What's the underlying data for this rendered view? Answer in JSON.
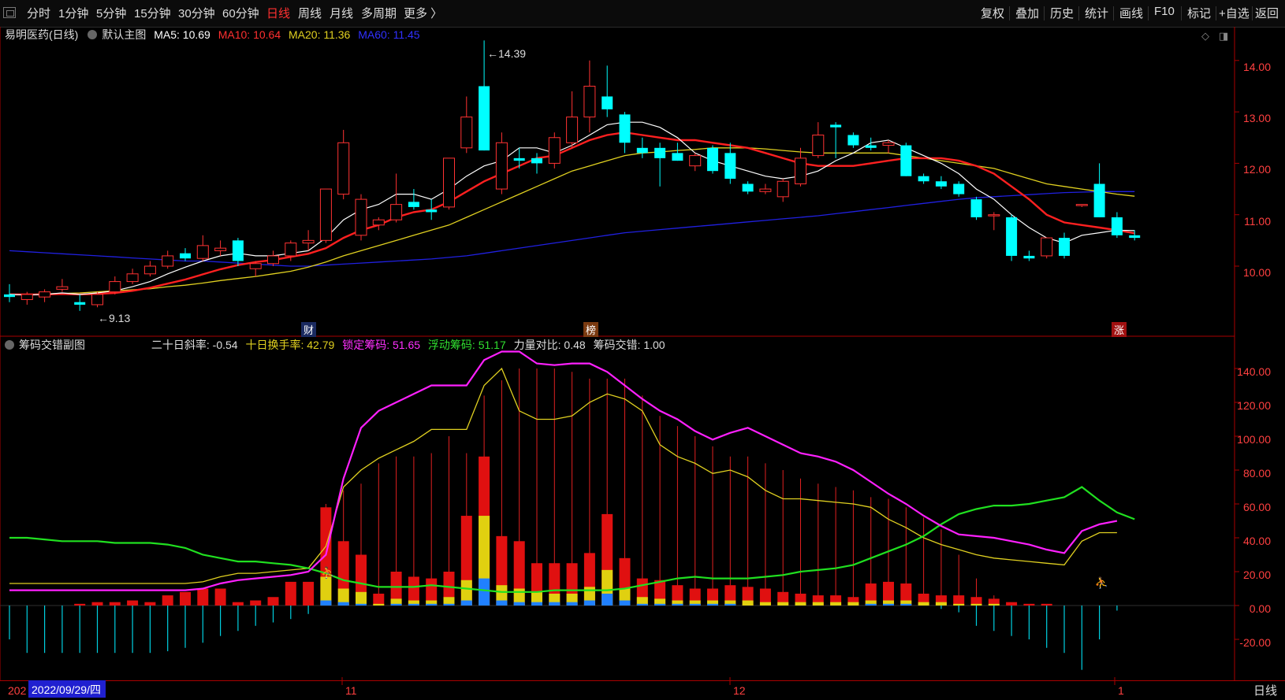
{
  "toolbar": {
    "left_items": [
      "分时",
      "1分钟",
      "5分钟",
      "15分钟",
      "30分钟",
      "60分钟",
      "日线",
      "周线",
      "月线",
      "多周期",
      "更多 〉"
    ],
    "active_item": "日线",
    "right_items": [
      "复权",
      "叠加",
      "历史",
      "统计",
      "画线",
      "F10",
      "标记",
      "+自选",
      "返回"
    ]
  },
  "main_info": {
    "stock": "易明医药(日线)",
    "template": "默认主图",
    "ma5": "MA5: 10.69",
    "ma10": "MA10: 10.64",
    "ma20": "MA20: 11.36",
    "ma60": "MA60: 11.45"
  },
  "sub_info": {
    "title": "筹码交错副图",
    "slope": "二十日斜率: -0.54",
    "turnover": "十日换手率: 42.79",
    "locked": "锁定筹码: 51.65",
    "floating": "浮动筹码: 51.17",
    "power": "力量对比: 0.48",
    "cross": "筹码交错: 1.00"
  },
  "main_axis": [
    "14.00",
    "13.00",
    "12.00",
    "11.00",
    "10.00"
  ],
  "sub_axis": [
    "140.00",
    "120.00",
    "100.00",
    "80.00",
    "60.00",
    "40.00",
    "20.00",
    "0.00",
    "-20.00"
  ],
  "annotations": {
    "high": "14.39",
    "low": "9.13"
  },
  "event_tags": [
    "财",
    "榜",
    "涨"
  ],
  "dates": {
    "cursor": "2022/09/29/四",
    "prefix": "202",
    "m11": "11",
    "m12": "12",
    "m1": "1"
  },
  "period": "日线",
  "colors": {
    "up": "#ff3232",
    "down": "#00ffff",
    "ma5": "#ffffff",
    "ma10": "#ff2020",
    "ma20": "#e0d020",
    "ma60": "#2020e0",
    "magenta": "#ff20ff",
    "green": "#20e020",
    "yellow": "#e0d020"
  },
  "chart_data": {
    "type": "candlestick",
    "candles": [
      {
        "o": 9.45,
        "h": 9.65,
        "l": 9.3,
        "c": 9.4
      },
      {
        "o": 9.35,
        "h": 9.5,
        "l": 9.25,
        "c": 9.45
      },
      {
        "o": 9.4,
        "h": 9.55,
        "l": 9.3,
        "c": 9.5
      },
      {
        "o": 9.55,
        "h": 9.75,
        "l": 9.5,
        "c": 9.6
      },
      {
        "o": 9.3,
        "h": 9.45,
        "l": 9.13,
        "c": 9.25
      },
      {
        "o": 9.25,
        "h": 9.5,
        "l": 9.2,
        "c": 9.45
      },
      {
        "o": 9.5,
        "h": 9.8,
        "l": 9.45,
        "c": 9.7
      },
      {
        "o": 9.7,
        "h": 9.95,
        "l": 9.65,
        "c": 9.85
      },
      {
        "o": 9.85,
        "h": 10.1,
        "l": 9.8,
        "c": 10.0
      },
      {
        "o": 10.0,
        "h": 10.3,
        "l": 9.95,
        "c": 10.2
      },
      {
        "o": 10.25,
        "h": 10.35,
        "l": 10.1,
        "c": 10.15
      },
      {
        "o": 10.15,
        "h": 10.6,
        "l": 10.1,
        "c": 10.4
      },
      {
        "o": 10.3,
        "h": 10.5,
        "l": 10.2,
        "c": 10.35
      },
      {
        "o": 10.5,
        "h": 10.55,
        "l": 10.0,
        "c": 10.1
      },
      {
        "o": 9.95,
        "h": 10.1,
        "l": 9.8,
        "c": 10.05
      },
      {
        "o": 10.05,
        "h": 10.3,
        "l": 10.0,
        "c": 10.2
      },
      {
        "o": 10.2,
        "h": 10.5,
        "l": 10.1,
        "c": 10.45
      },
      {
        "o": 10.45,
        "h": 10.7,
        "l": 10.3,
        "c": 10.5
      },
      {
        "o": 10.5,
        "h": 11.5,
        "l": 10.45,
        "c": 11.5
      },
      {
        "o": 11.4,
        "h": 12.65,
        "l": 11.3,
        "c": 12.4
      },
      {
        "o": 10.6,
        "h": 11.4,
        "l": 10.5,
        "c": 11.3
      },
      {
        "o": 10.8,
        "h": 10.95,
        "l": 10.7,
        "c": 10.9
      },
      {
        "o": 10.9,
        "h": 11.8,
        "l": 10.85,
        "c": 11.2
      },
      {
        "o": 11.25,
        "h": 11.5,
        "l": 11.1,
        "c": 11.15
      },
      {
        "o": 11.1,
        "h": 11.3,
        "l": 10.9,
        "c": 11.05
      },
      {
        "o": 11.15,
        "h": 12.1,
        "l": 11.1,
        "c": 12.1
      },
      {
        "o": 12.3,
        "h": 13.3,
        "l": 12.2,
        "c": 12.9
      },
      {
        "o": 13.5,
        "h": 14.39,
        "l": 12.25,
        "c": 12.25
      },
      {
        "o": 11.5,
        "h": 12.6,
        "l": 11.4,
        "c": 12.4
      },
      {
        "o": 12.1,
        "h": 12.3,
        "l": 11.9,
        "c": 12.05
      },
      {
        "o": 12.1,
        "h": 12.2,
        "l": 11.8,
        "c": 12.0
      },
      {
        "o": 12.0,
        "h": 12.6,
        "l": 11.9,
        "c": 12.5
      },
      {
        "o": 12.4,
        "h": 13.4,
        "l": 12.3,
        "c": 12.9
      },
      {
        "o": 12.9,
        "h": 14.0,
        "l": 12.6,
        "c": 13.5
      },
      {
        "o": 13.3,
        "h": 13.9,
        "l": 12.9,
        "c": 13.05
      },
      {
        "o": 12.95,
        "h": 13.0,
        "l": 12.2,
        "c": 12.4
      },
      {
        "o": 12.3,
        "h": 12.5,
        "l": 12.1,
        "c": 12.2
      },
      {
        "o": 12.3,
        "h": 12.4,
        "l": 11.55,
        "c": 12.1
      },
      {
        "o": 12.2,
        "h": 12.4,
        "l": 12.05,
        "c": 12.05
      },
      {
        "o": 11.95,
        "h": 12.2,
        "l": 11.85,
        "c": 12.15
      },
      {
        "o": 12.3,
        "h": 12.35,
        "l": 11.8,
        "c": 11.85
      },
      {
        "o": 12.2,
        "h": 12.4,
        "l": 11.6,
        "c": 11.7
      },
      {
        "o": 11.6,
        "h": 11.65,
        "l": 11.4,
        "c": 11.45
      },
      {
        "o": 11.45,
        "h": 11.6,
        "l": 11.4,
        "c": 11.5
      },
      {
        "o": 11.35,
        "h": 11.7,
        "l": 11.25,
        "c": 11.65
      },
      {
        "o": 11.6,
        "h": 12.3,
        "l": 11.55,
        "c": 12.1
      },
      {
        "o": 12.15,
        "h": 12.8,
        "l": 12.1,
        "c": 12.55
      },
      {
        "o": 12.75,
        "h": 12.8,
        "l": 12.1,
        "c": 12.7
      },
      {
        "o": 12.55,
        "h": 12.6,
        "l": 12.3,
        "c": 12.35
      },
      {
        "o": 12.35,
        "h": 12.5,
        "l": 12.25,
        "c": 12.3
      },
      {
        "o": 12.35,
        "h": 12.45,
        "l": 12.2,
        "c": 12.4
      },
      {
        "o": 12.35,
        "h": 12.4,
        "l": 11.75,
        "c": 11.75
      },
      {
        "o": 11.75,
        "h": 11.8,
        "l": 11.6,
        "c": 11.65
      },
      {
        "o": 11.65,
        "h": 11.75,
        "l": 11.5,
        "c": 11.55
      },
      {
        "o": 11.6,
        "h": 11.65,
        "l": 11.35,
        "c": 11.4
      },
      {
        "o": 11.3,
        "h": 11.35,
        "l": 10.9,
        "c": 10.95
      },
      {
        "o": 11.0,
        "h": 11.05,
        "l": 10.7,
        "c": 11.0
      },
      {
        "o": 10.95,
        "h": 11.0,
        "l": 10.1,
        "c": 10.2
      },
      {
        "o": 10.2,
        "h": 10.3,
        "l": 10.1,
        "c": 10.15
      },
      {
        "o": 10.2,
        "h": 10.55,
        "l": 10.15,
        "c": 10.55
      },
      {
        "o": 10.55,
        "h": 10.65,
        "l": 10.15,
        "c": 10.2
      },
      {
        "o": 11.2,
        "h": 11.2,
        "l": 11.15,
        "c": 11.2
      },
      {
        "o": 11.6,
        "h": 12.0,
        "l": 10.95,
        "c": 10.95
      },
      {
        "o": 10.95,
        "h": 11.05,
        "l": 10.55,
        "c": 10.6
      },
      {
        "o": 10.6,
        "h": 10.7,
        "l": 10.5,
        "c": 10.55
      }
    ],
    "ma5": [
      9.45,
      9.44,
      9.45,
      9.48,
      9.45,
      9.48,
      9.52,
      9.6,
      9.7,
      9.85,
      9.98,
      10.1,
      10.2,
      10.25,
      10.2,
      10.2,
      10.25,
      10.3,
      10.55,
      10.9,
      11.1,
      11.2,
      11.4,
      11.4,
      11.3,
      11.5,
      11.75,
      11.95,
      12.05,
      12.3,
      12.3,
      12.2,
      12.35,
      12.55,
      12.75,
      12.8,
      12.8,
      12.7,
      12.5,
      12.2,
      12.05,
      11.95,
      11.85,
      11.75,
      11.7,
      11.75,
      11.85,
      12.05,
      12.2,
      12.4,
      12.45,
      12.3,
      12.15,
      12.0,
      11.8,
      11.5,
      11.3,
      11.0,
      10.75,
      10.55,
      10.45,
      10.6,
      10.65,
      10.7,
      10.69
    ],
    "ma10": [
      9.45,
      9.45,
      9.45,
      9.46,
      9.45,
      9.46,
      9.48,
      9.52,
      9.58,
      9.66,
      9.74,
      9.84,
      9.94,
      10.02,
      10.08,
      10.12,
      10.18,
      10.24,
      10.35,
      10.55,
      10.7,
      10.8,
      10.95,
      11.05,
      11.1,
      11.25,
      11.45,
      11.65,
      11.8,
      11.95,
      12.1,
      12.15,
      12.3,
      12.45,
      12.55,
      12.6,
      12.55,
      12.5,
      12.45,
      12.45,
      12.4,
      12.35,
      12.3,
      12.2,
      12.1,
      12.0,
      11.95,
      11.95,
      11.95,
      12.0,
      12.05,
      12.1,
      12.1,
      12.1,
      12.05,
      11.95,
      11.8,
      11.55,
      11.3,
      11.0,
      10.85,
      10.8,
      10.75,
      10.7,
      10.64
    ],
    "ma20": [
      9.45,
      9.45,
      9.46,
      9.47,
      9.48,
      9.5,
      9.52,
      9.54,
      9.56,
      9.6,
      9.63,
      9.67,
      9.72,
      9.76,
      9.8,
      9.85,
      9.9,
      9.98,
      10.08,
      10.2,
      10.3,
      10.4,
      10.5,
      10.6,
      10.7,
      10.8,
      10.95,
      11.1,
      11.25,
      11.4,
      11.55,
      11.7,
      11.85,
      11.95,
      12.05,
      12.15,
      12.2,
      12.22,
      12.25,
      12.27,
      12.3,
      12.3,
      12.3,
      12.28,
      12.25,
      12.22,
      12.2,
      12.2,
      12.2,
      12.2,
      12.2,
      12.15,
      12.1,
      12.05,
      12.0,
      11.95,
      11.9,
      11.8,
      11.7,
      11.6,
      11.55,
      11.5,
      11.45,
      11.4,
      11.36
    ],
    "ma60": [
      10.3,
      10.28,
      10.26,
      10.24,
      10.22,
      10.2,
      10.18,
      10.16,
      10.14,
      10.12,
      10.1,
      10.1,
      10.08,
      10.06,
      10.04,
      10.02,
      10.0,
      10.0,
      10.02,
      10.04,
      10.06,
      10.08,
      10.1,
      10.12,
      10.14,
      10.17,
      10.2,
      10.25,
      10.3,
      10.35,
      10.4,
      10.45,
      10.5,
      10.55,
      10.6,
      10.65,
      10.68,
      10.71,
      10.74,
      10.77,
      10.8,
      10.83,
      10.86,
      10.89,
      10.92,
      10.95,
      10.98,
      11.02,
      11.06,
      11.1,
      11.14,
      11.18,
      11.22,
      11.26,
      11.3,
      11.33,
      11.35,
      11.37,
      11.39,
      11.41,
      11.43,
      11.44,
      11.45,
      11.45,
      11.45
    ],
    "sub": {
      "magenta": [
        9,
        9,
        9,
        9,
        9,
        9,
        9,
        9,
        9,
        9,
        9,
        10,
        13,
        15,
        16,
        17,
        18,
        20,
        30,
        75,
        105,
        115,
        120,
        125,
        130,
        130,
        130,
        145,
        150,
        150,
        143,
        142,
        143,
        143,
        138,
        130,
        122,
        115,
        110,
        103,
        98,
        102,
        105,
        100,
        95,
        90,
        88,
        85,
        80,
        73,
        66,
        60,
        53,
        47,
        42,
        41,
        40,
        38,
        36,
        33,
        31,
        44,
        48,
        50
      ],
      "yellow": [
        13,
        13,
        13,
        13,
        13,
        13,
        13,
        13,
        13,
        13,
        13,
        14,
        17,
        19,
        19,
        20,
        21,
        22,
        35,
        70,
        80,
        87,
        92,
        97,
        104,
        104,
        104,
        130,
        140,
        115,
        110,
        110,
        112,
        120,
        125,
        122,
        115,
        95,
        88,
        84,
        78,
        80,
        76,
        68,
        63,
        63,
        62,
        61,
        60,
        58,
        51,
        46,
        40,
        36,
        33,
        30,
        28,
        27,
        26,
        25,
        24,
        38,
        43,
        43
      ],
      "green": [
        40,
        40,
        39,
        38,
        38,
        38,
        37,
        37,
        37,
        36,
        34,
        30,
        28,
        26,
        26,
        25,
        24,
        22,
        19,
        15,
        13,
        11,
        11,
        11,
        12,
        11,
        10,
        9,
        8,
        8,
        8,
        9,
        9,
        9,
        9,
        10,
        12,
        14,
        16,
        17,
        16,
        16,
        16,
        17,
        18,
        20,
        21,
        22,
        24,
        28,
        32,
        36,
        41,
        48,
        54,
        57,
        59,
        59,
        60,
        62,
        64,
        70,
        62,
        55,
        51
      ],
      "bars_total": [
        0,
        0,
        0,
        0,
        1,
        2,
        2,
        3,
        2,
        6,
        8,
        10,
        10,
        2,
        3,
        5,
        14,
        14,
        58,
        38,
        30,
        7,
        20,
        17,
        16,
        20,
        53,
        88,
        41,
        38,
        25,
        25,
        25,
        31,
        54,
        28,
        16,
        15,
        12,
        10,
        10,
        12,
        11,
        10,
        8,
        7,
        6,
        6,
        5,
        13,
        14,
        13,
        7,
        6,
        6,
        5,
        4,
        2,
        1,
        1,
        0,
        0,
        0,
        0,
        0
      ],
      "bars_yellow": [
        0,
        0,
        0,
        0,
        0,
        0,
        0,
        0,
        0,
        0,
        0,
        0,
        0,
        0,
        0,
        0,
        0,
        0,
        17,
        10,
        8,
        1,
        4,
        3,
        3,
        5,
        15,
        53,
        12,
        10,
        8,
        7,
        7,
        11,
        21,
        10,
        5,
        4,
        3,
        3,
        3,
        3,
        3,
        2,
        2,
        2,
        2,
        2,
        2,
        3,
        3,
        3,
        2,
        2,
        1,
        1,
        1,
        0,
        0,
        0,
        0,
        0,
        0,
        0,
        0
      ],
      "bars_blue": [
        0,
        0,
        0,
        0,
        0,
        0,
        0,
        0,
        0,
        0,
        0,
        0,
        0,
        0,
        0,
        0,
        0,
        0,
        3,
        2,
        1,
        0,
        1,
        1,
        1,
        1,
        3,
        16,
        3,
        2,
        2,
        2,
        2,
        3,
        7,
        3,
        1,
        1,
        1,
        1,
        1,
        1,
        0,
        0,
        0,
        0,
        0,
        0,
        0,
        1,
        1,
        1,
        0,
        0,
        0,
        0,
        0,
        0,
        0,
        0,
        0,
        0,
        0,
        0,
        0
      ],
      "spikes": [
        0,
        0,
        0,
        0,
        0,
        0,
        0,
        0,
        0,
        0,
        0,
        0,
        0,
        0,
        0,
        0,
        0,
        0,
        60,
        68,
        72,
        84,
        88,
        88,
        90,
        100,
        90,
        124,
        133,
        140,
        140,
        140,
        138,
        134,
        134,
        134,
        124,
        112,
        106,
        100,
        94,
        88,
        88,
        84,
        80,
        75,
        72,
        70,
        68,
        64,
        63,
        58,
        52,
        45,
        30,
        16,
        6,
        0,
        0,
        0,
        0,
        0,
        0,
        0,
        0
      ],
      "neg": [
        -20,
        -28,
        -28,
        -28,
        -28,
        -28,
        -28,
        -28,
        -28,
        -27,
        -25,
        -22,
        -18,
        -15,
        -12,
        -10,
        -8,
        -5,
        0,
        0,
        0,
        0,
        0,
        0,
        0,
        0,
        0,
        0,
        0,
        0,
        0,
        0,
        0,
        0,
        0,
        0,
        0,
        0,
        0,
        0,
        0,
        0,
        0,
        0,
        0,
        0,
        0,
        0,
        0,
        0,
        0,
        0,
        0,
        -2,
        -4,
        -12,
        -15,
        -18,
        -20,
        -25,
        -28,
        -38,
        -20,
        -3,
        0
      ]
    }
  }
}
